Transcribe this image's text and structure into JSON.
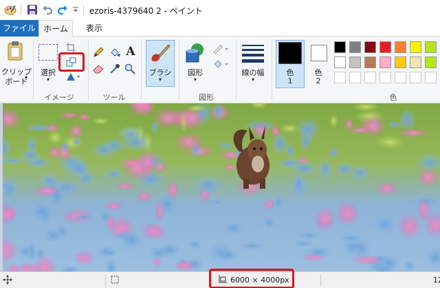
{
  "window": {
    "title": "ezoris-4379640 2 - ペイント"
  },
  "tabs": {
    "file": "ファイル",
    "home": "ホーム",
    "view": "表示"
  },
  "ribbon": {
    "clipboard": {
      "paste_label_1": "クリップ",
      "paste_label_2": "ボード"
    },
    "image": {
      "select_label": "選択",
      "group_label": "イメージ"
    },
    "tools": {
      "group_label": "ツール",
      "text_glyph": "A"
    },
    "brushes": {
      "label": "ブラシ"
    },
    "shapes": {
      "shape_label": "図形",
      "group_label": "図形"
    },
    "size": {
      "label": "線の幅"
    },
    "colors": {
      "color1_label": "色",
      "color1_num": "1",
      "color2_label": "色",
      "color2_num": "2",
      "group_label": "色",
      "color1_value": "#000000",
      "color2_value": "#ffffff",
      "palette_row1": [
        "#000000",
        "#7f7f7f",
        "#880015",
        "#ed1c24",
        "#ff7f27",
        "#fff200",
        "#b5e61d"
      ],
      "palette_row2": [
        "#ffffff",
        "#c3c3c3",
        "#b97a57",
        "#ffaec9",
        "#ffc90e",
        "#efe4b0",
        "#b5e61d"
      ],
      "palette_row3": [
        "#ffffff",
        "#ffffff",
        "#ffffff",
        "#ffffff",
        "#ffffff",
        "#ffffff",
        "#ffffff"
      ]
    }
  },
  "statusbar": {
    "image_size": "6000 × 4000px",
    "zoom_partial": "12"
  },
  "highlight_color": "#d9141b"
}
